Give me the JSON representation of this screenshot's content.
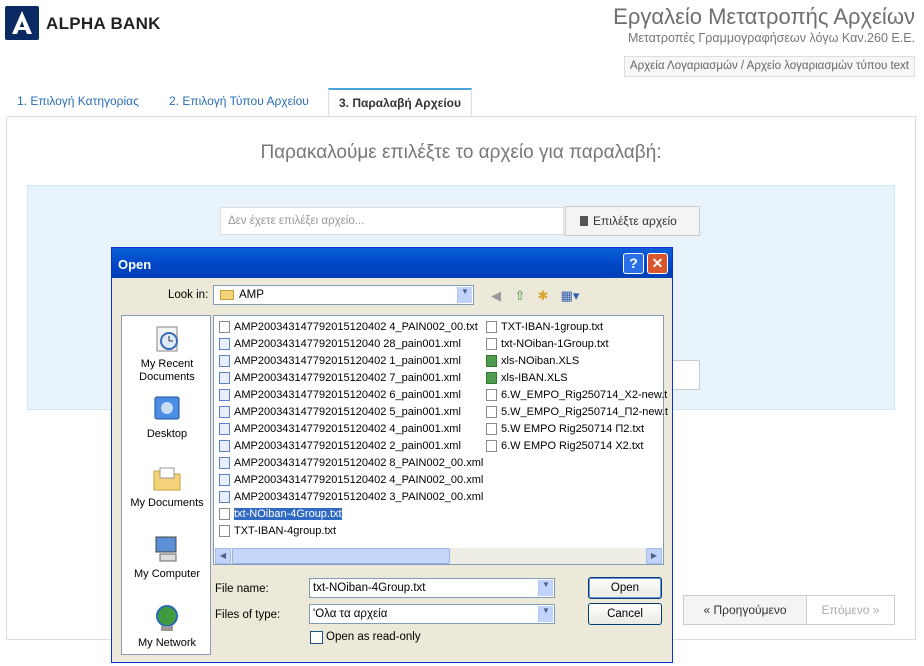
{
  "header": {
    "brand": "ALPHA BANK",
    "app_title": "Εργαλείο Μετατροπής Αρχείων",
    "app_subtitle": "Μετατροπές Γραμμογραφήσεων λόγω Καν.260 Ε.Ε.",
    "breadcrumb": "Αρχεία Λογαριασμών / Αρχείο λογαριασμών τύπου text"
  },
  "tabs": [
    {
      "label": "1. Επιλογή Κατηγορίας"
    },
    {
      "label": "2. Επιλογή Τύπου Αρχείου"
    },
    {
      "label": "3. Παραλαβή Αρχείου"
    }
  ],
  "main": {
    "heading": "Παρακαλούμε επιλέξτε το αρχείο για παραλαβή:",
    "file_placeholder": "Δεν έχετε επιλέξει αρχείο...",
    "choose_label": "Επιλέξτε αρχείο",
    "prev_label": "« Προηγούμενο",
    "next_label": "Επόμενο »"
  },
  "dialog": {
    "title": "Open",
    "help": "?",
    "close": "✕",
    "look_in_label": "Look in:",
    "look_in_value": "AMP",
    "places": [
      {
        "label": "My Recent Documents",
        "icon": "recent-documents-icon"
      },
      {
        "label": "Desktop",
        "icon": "desktop-icon"
      },
      {
        "label": "My Documents",
        "icon": "my-documents-icon"
      },
      {
        "label": "My Computer",
        "icon": "my-computer-icon"
      },
      {
        "label": "My Network",
        "icon": "my-network-icon"
      }
    ],
    "files_col1": [
      {
        "name": "AMP200343147792015120402 4_PAIN002_00.txt",
        "type": "txt"
      },
      {
        "name": "AMP20034314779201512040 28_pain001.xml",
        "type": "xml"
      },
      {
        "name": "AMP200343147792015120402 1_pain001.xml",
        "type": "xml"
      },
      {
        "name": "AMP200343147792015120402 7_pain001.xml",
        "type": "xml"
      },
      {
        "name": "AMP200343147792015120402 6_pain001.xml",
        "type": "xml"
      },
      {
        "name": "AMP200343147792015120402 5_pain001.xml",
        "type": "xml"
      },
      {
        "name": "AMP200343147792015120402 4_pain001.xml",
        "type": "xml"
      },
      {
        "name": "AMP200343147792015120402 2_pain001.xml",
        "type": "xml"
      },
      {
        "name": "AMP200343147792015120402 8_PAIN002_00.xml",
        "type": "xml"
      },
      {
        "name": "AMP200343147792015120402 4_PAIN002_00.xml",
        "type": "xml"
      },
      {
        "name": "AMP200343147792015120402 3_PAIN002_00.xml",
        "type": "xml"
      },
      {
        "name": "txt-NOiban-4Group.txt",
        "type": "txt",
        "selected": true
      },
      {
        "name": "TXT-IBAN-4group.txt",
        "type": "txt"
      }
    ],
    "files_col2": [
      {
        "name": "TXT-IBAN-1group.txt",
        "type": "txt"
      },
      {
        "name": "txt-NOiban-1Group.txt",
        "type": "txt"
      },
      {
        "name": "xls-NOiban.XLS",
        "type": "xls"
      },
      {
        "name": "xls-IBAN.XLS",
        "type": "xls"
      },
      {
        "name": "6.W_EMPO_Rig250714_X2-new.t",
        "type": "txt"
      },
      {
        "name": "5.W_EMPO_Rig250714_Π2-new.t",
        "type": "txt"
      },
      {
        "name": "5.W EMPO Rig250714 Π2.txt",
        "type": "txt"
      },
      {
        "name": "6.W EMPO Rig250714 X2.txt",
        "type": "txt"
      }
    ],
    "file_name_label": "File name:",
    "file_name_value": "txt-NOiban-4Group.txt",
    "files_of_type_label": "Files of type:",
    "files_of_type_value": "'Ολα τα αρχεία",
    "read_only_label": "Open as read-only",
    "open_label": "Open",
    "cancel_label": "Cancel"
  },
  "colors": {
    "accent": "#2a6db5",
    "titlebar": "#0054e3",
    "selection": "#316ac5"
  }
}
